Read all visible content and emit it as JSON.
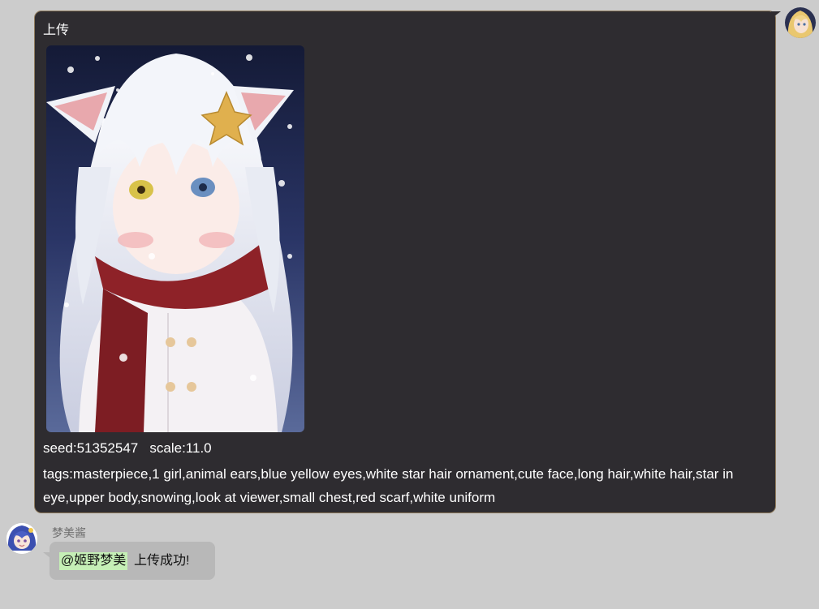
{
  "outgoing_message": {
    "title": "上传",
    "image": {
      "alt": "white-haired cat-ear girl in red scarf and white coat, snowy night background",
      "colors": {
        "background": "#1c2447",
        "hair": "#eceff6",
        "scarf": "#8e2228",
        "coat": "#f4f1f4",
        "star": "#e0b04e",
        "eyes": "#d8c24a"
      }
    },
    "params_line": "seed:51352547   scale:11.0",
    "tags_line": "tags:masterpiece,1 girl,animal ears,blue yellow eyes,white star hair ornament,cute face,long hair,white hair,star in eye,upper body,snowing,look at viewer,small chest,red scarf,white uniform",
    "bubble_color": "#2e2c30",
    "border_color": "#8e7a5c"
  },
  "incoming_message": {
    "sender": "梦美酱",
    "mention": "@姬野梦美",
    "text": "上传成功!",
    "bubble_color": "#b8b8b8",
    "mention_color": "#c5efb6"
  },
  "avatars": {
    "self": {
      "icon": "blonde-character-avatar-icon"
    },
    "bot": {
      "icon": "blue-hair-character-avatar-icon"
    }
  }
}
